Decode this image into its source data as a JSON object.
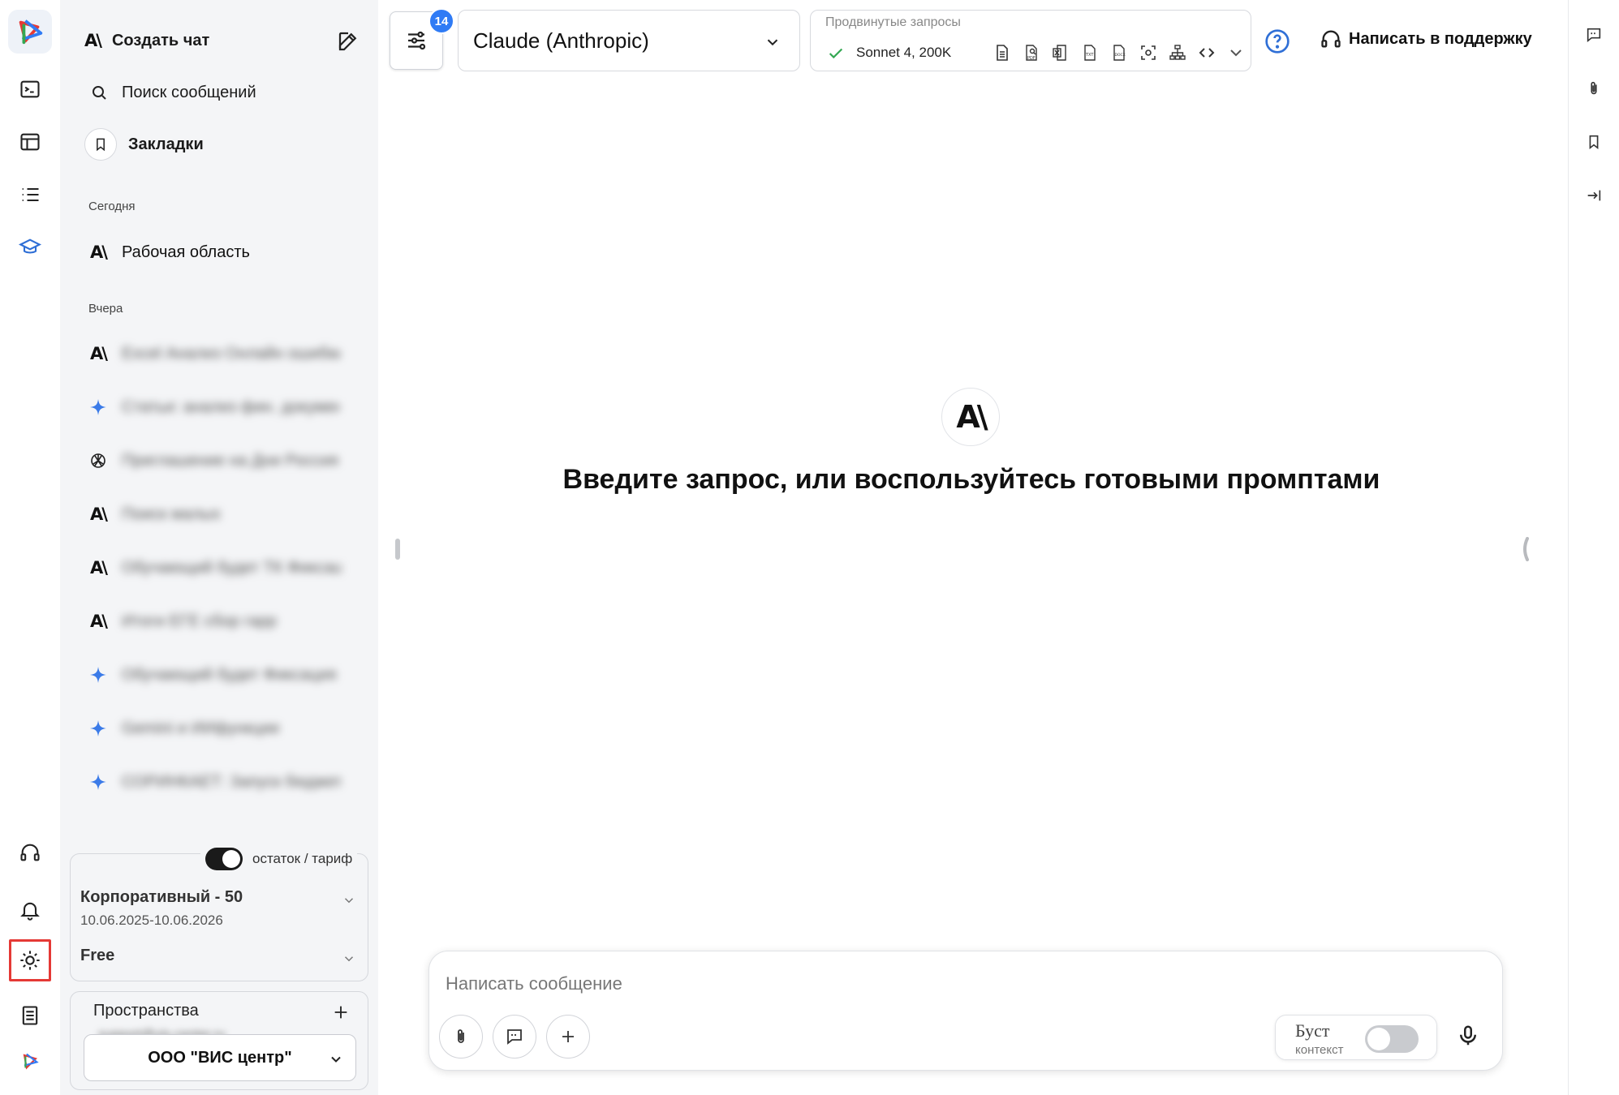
{
  "rail": {
    "items": [
      "app-logo",
      "terminal-icon",
      "table-icon",
      "list-icon",
      "graduation-cap-icon"
    ],
    "bottom": [
      "headset-icon",
      "bell-icon",
      "sun-icon",
      "document-icon",
      "vis-gpt-logo"
    ]
  },
  "sidebar": {
    "new_chat_label": "Создать чат",
    "search_label": "Поиск сообщений",
    "bookmarks_label": "Закладки",
    "today_title": "Сегодня",
    "today_items": [
      {
        "icon": "anthropic-icon",
        "label": "Рабочая область"
      }
    ],
    "yesterday_title": "Вчера",
    "yesterday_items": [
      {
        "icon": "anthropic-icon",
        "label": "Excel Анализ Онлайн ошибки"
      },
      {
        "icon": "gemini-icon",
        "label": "Статьи: анализ фин. документов"
      },
      {
        "icon": "openai-icon",
        "label": "Приглашение на Дни Россия"
      },
      {
        "icon": "anthropic-icon",
        "label": "Поиск малых"
      },
      {
        "icon": "anthropic-icon",
        "label": "Обучающий будет ТК Фиксация"
      },
      {
        "icon": "anthropic-icon",
        "label": "Итоги ЕГЕ сбор гарр"
      },
      {
        "icon": "gemini-icon",
        "label": "Обучающий будет Фиксация кол"
      },
      {
        "icon": "gemini-icon",
        "label": "Gemini и ИИфункции"
      },
      {
        "icon": "gemini-icon",
        "label": "СОРИНКАЕТ: Запуск бюджет"
      }
    ],
    "plan": {
      "toggle_label": "остаток / тариф",
      "name": "Корпоративный - 50",
      "dates": "10.06.2025-10.06.2026",
      "tier": "Free"
    },
    "spaces": {
      "title": "Пространства",
      "email": "support@vis-center.ru",
      "org": "ООО \"ВИС центр\""
    }
  },
  "topbar": {
    "badge_count": "14",
    "model": "Claude (Anthropic)",
    "advanced_title": "Продвинутые запросы",
    "advanced_model": "Sonnet 4, 200K",
    "support_label": "Написать в поддержку"
  },
  "main": {
    "empty_text": "Введите запрос, или воспользуйтесь готовыми промптами"
  },
  "composer": {
    "placeholder": "Написать сообщение",
    "boost_label": "Буст",
    "boost_sub": "контекст"
  },
  "colors": {
    "accent": "#2f7bf5",
    "active_outline": "#e53935",
    "check": "#34a853",
    "sidebar_bg": "#f4f5f7"
  }
}
